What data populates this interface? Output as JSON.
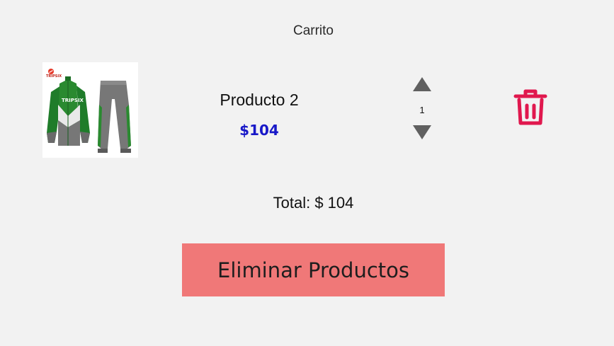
{
  "cart": {
    "title": "Carrito"
  },
  "item": {
    "name": "Producto 2",
    "price": "$104",
    "quantity": "1",
    "image_logo_text": "TRIPSIX",
    "icons": {
      "increase": "triangle-up-icon",
      "decrease": "triangle-down-icon",
      "delete": "trash-icon"
    }
  },
  "summary": {
    "total": "Total: $ 104"
  },
  "actions": {
    "remove_all_label": "Eliminar Productos"
  },
  "colors": {
    "background": "#f2f2f2",
    "price": "#1818c8",
    "delete_icon": "#e0184e",
    "remove_button": "#f07878",
    "arrows": "#606060"
  }
}
